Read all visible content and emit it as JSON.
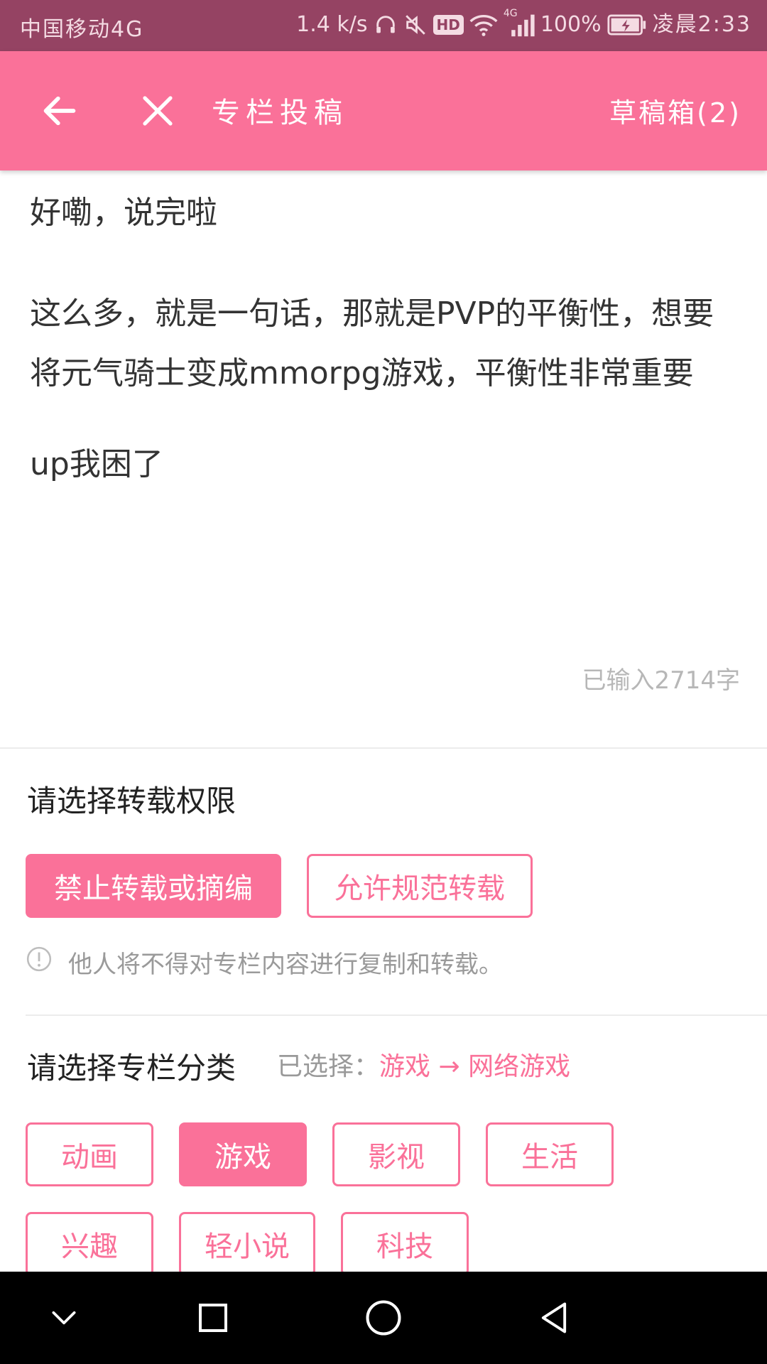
{
  "status_bar": {
    "carrier": "中国移动4G",
    "speed": "1.4 k/s",
    "hd": "HD",
    "network": "4G",
    "battery": "100%",
    "time": "凌晨2:33"
  },
  "app_bar": {
    "title": "专栏投稿",
    "drafts": "草稿箱(2)"
  },
  "article": {
    "paragraphs": [
      "好嘞，说完啦",
      "这么多，就是一句话，那就是PVP的平衡性，想要将元气骑士变成mmorpg游戏，平衡性非常重要",
      "up我困了"
    ],
    "word_count": "已输入2714字"
  },
  "repost": {
    "title": "请选择转载权限",
    "options": [
      "禁止转载或摘编",
      "允许规范转载"
    ],
    "selected_index": 0,
    "hint": "他人将不得对专栏内容进行复制和转载。"
  },
  "category": {
    "title": "请选择专栏分类",
    "selected_label": "已选择：",
    "selected_value": "游戏 → 网络游戏",
    "options": [
      "动画",
      "游戏",
      "影视",
      "生活",
      "兴趣",
      "轻小说",
      "科技"
    ],
    "selected_index": 1
  },
  "colors": {
    "accent": "#fa7199",
    "status_bar": "#954363"
  },
  "icons": {
    "back": "arrow-left-icon",
    "close": "close-icon",
    "info": "info-icon",
    "nav": [
      "chevron-down-icon",
      "square-icon",
      "circle-icon",
      "triangle-back-icon"
    ]
  }
}
